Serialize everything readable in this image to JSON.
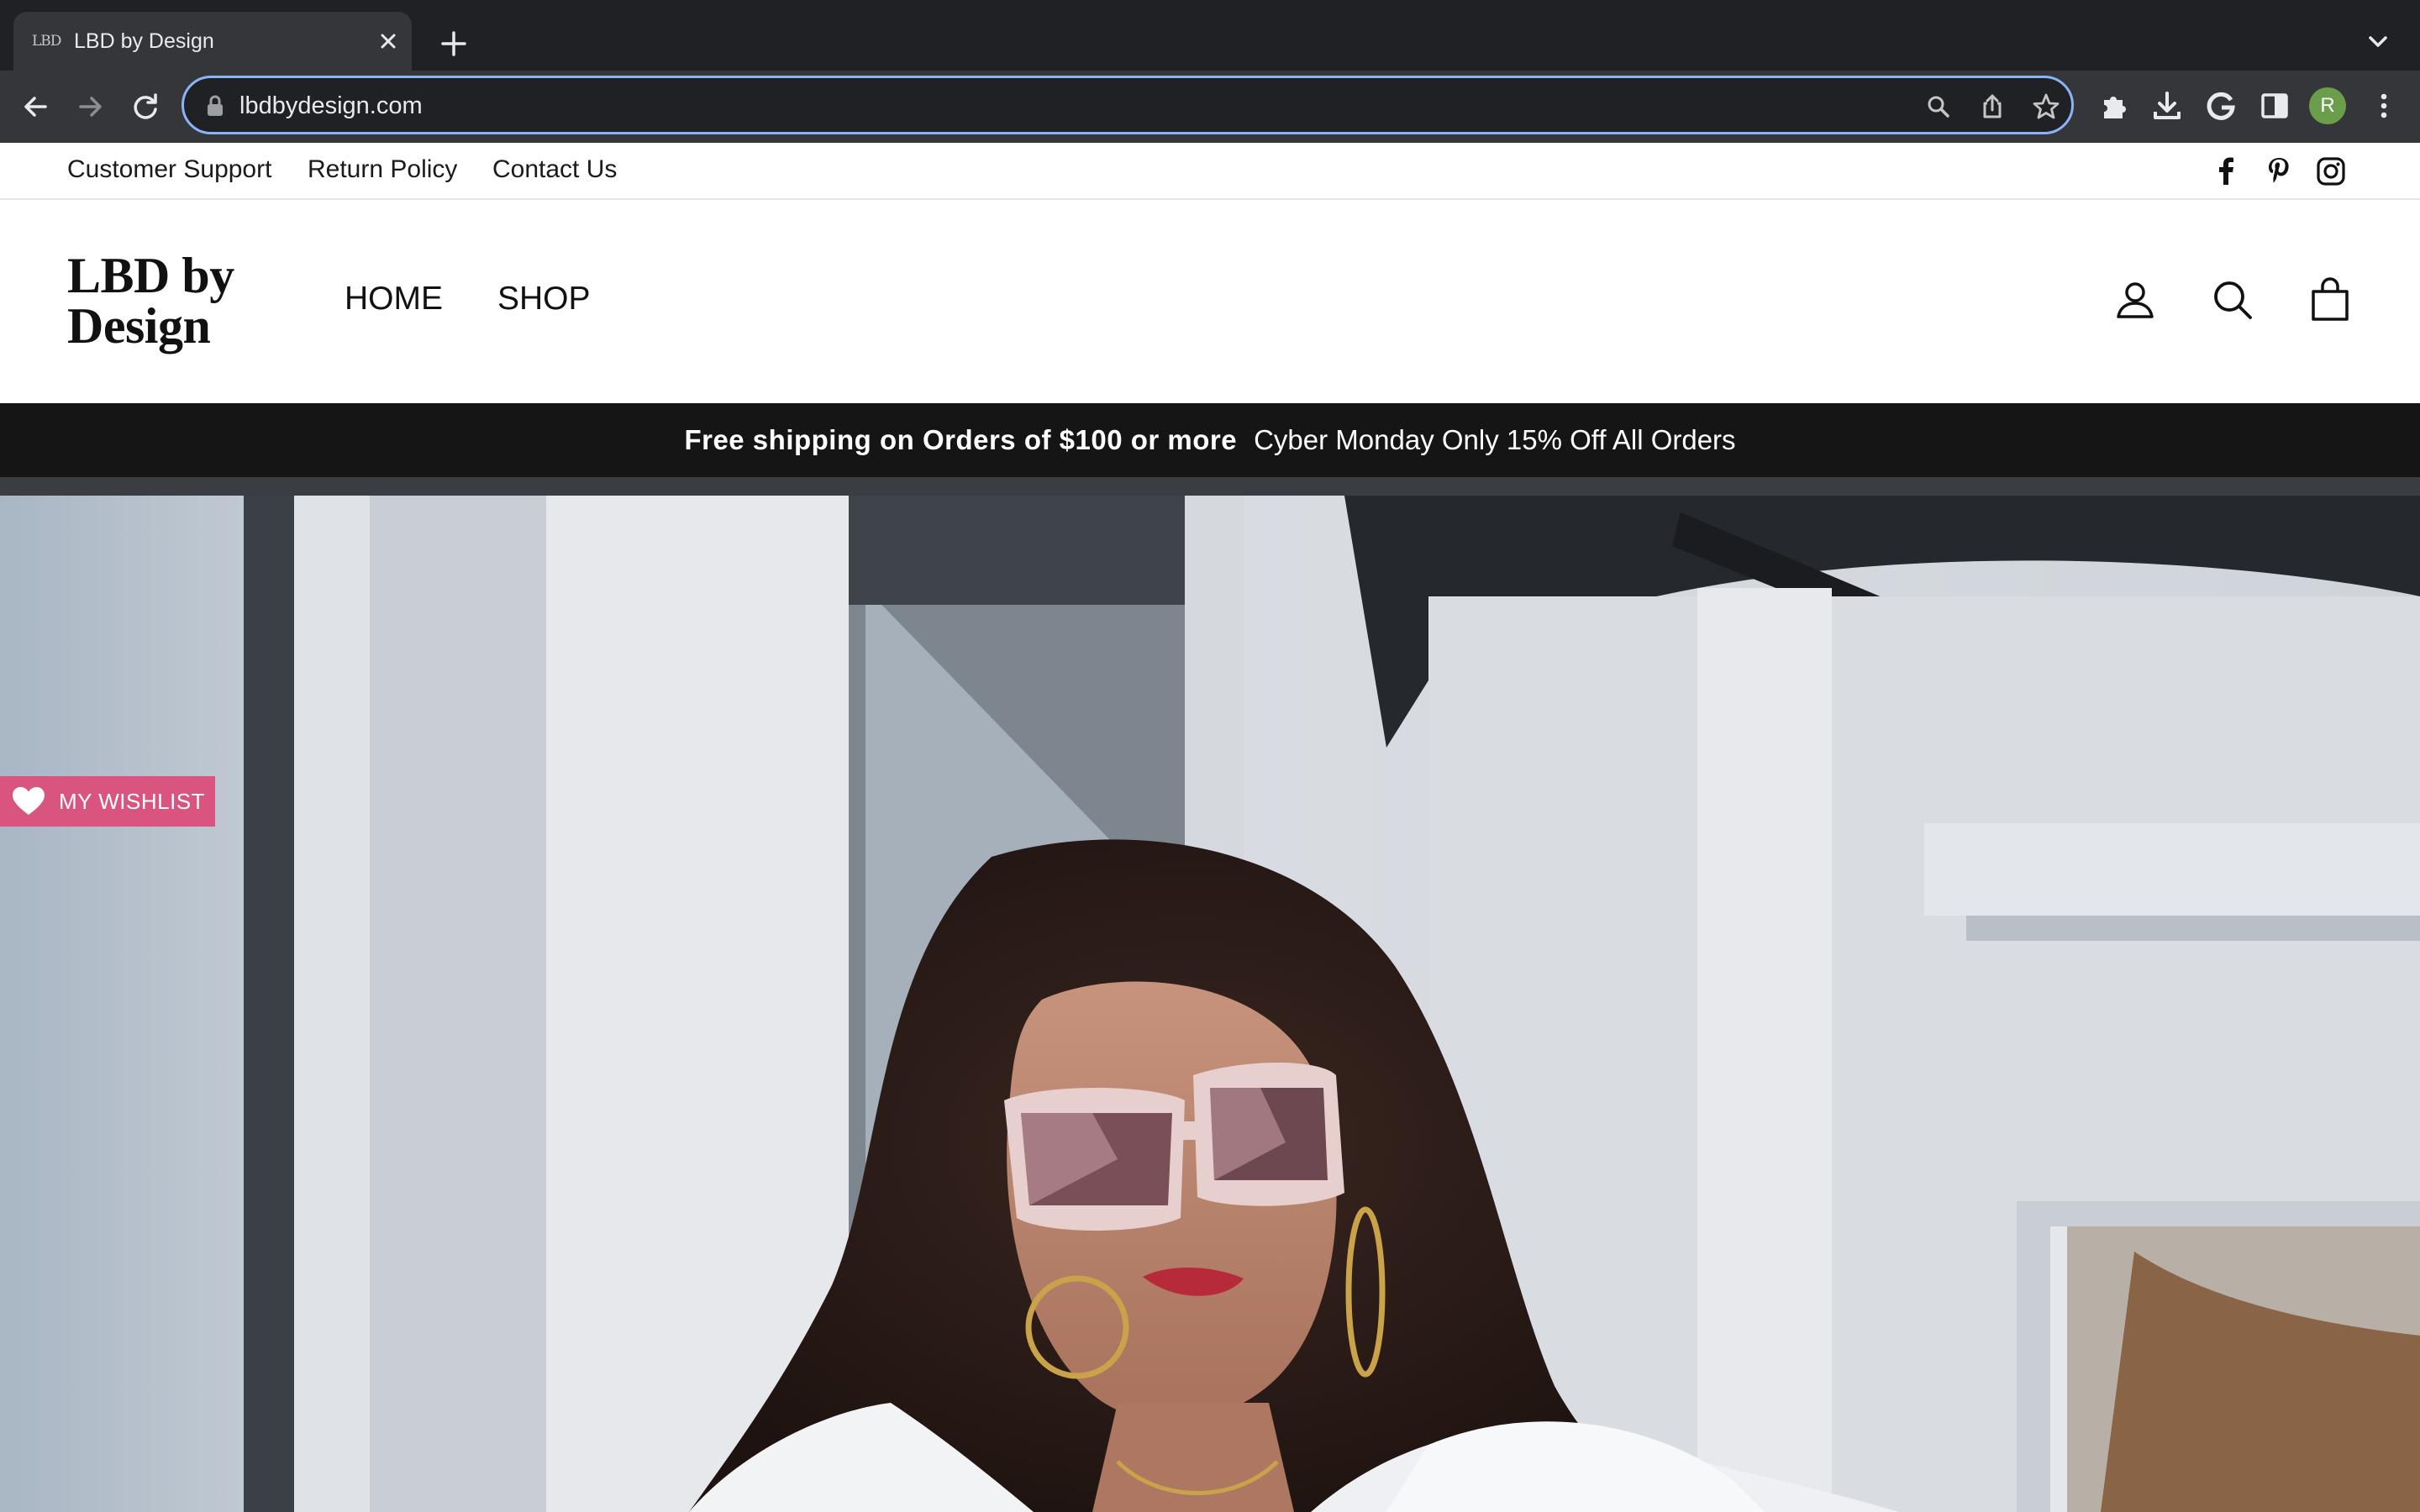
{
  "browser": {
    "tab_title": "LBD by Design",
    "tab_favicon_text": "LBD",
    "url": "lbdbydesign.com",
    "profile_initial": "R",
    "profile_color": "#6b9e4a",
    "focus_ring_color": "#8ab4f8",
    "icons": [
      "back-icon",
      "forward-icon",
      "reload-icon",
      "lock-icon",
      "zoom-icon",
      "share-icon",
      "bookmark-star-icon",
      "extensions-icon",
      "download-icon",
      "google-icon",
      "side-panel-icon",
      "menu-dots-icon"
    ]
  },
  "utility_bar": {
    "links": [
      "Customer Support",
      "Return Policy",
      "Contact Us"
    ],
    "social_icons": [
      "facebook-icon",
      "pinterest-icon",
      "instagram-icon"
    ]
  },
  "header": {
    "logo_line1": "LBD by",
    "logo_line2": "Design",
    "nav": [
      "HOME",
      "SHOP"
    ],
    "icons": [
      "account-icon",
      "search-icon",
      "cart-icon"
    ]
  },
  "announcement": {
    "bold_text": "Free shipping on Orders of $100 or more",
    "text": "Cyber Monday Only 15% Off All Orders"
  },
  "wishlist": {
    "label": "MY WISHLIST",
    "color": "#d9547e"
  }
}
